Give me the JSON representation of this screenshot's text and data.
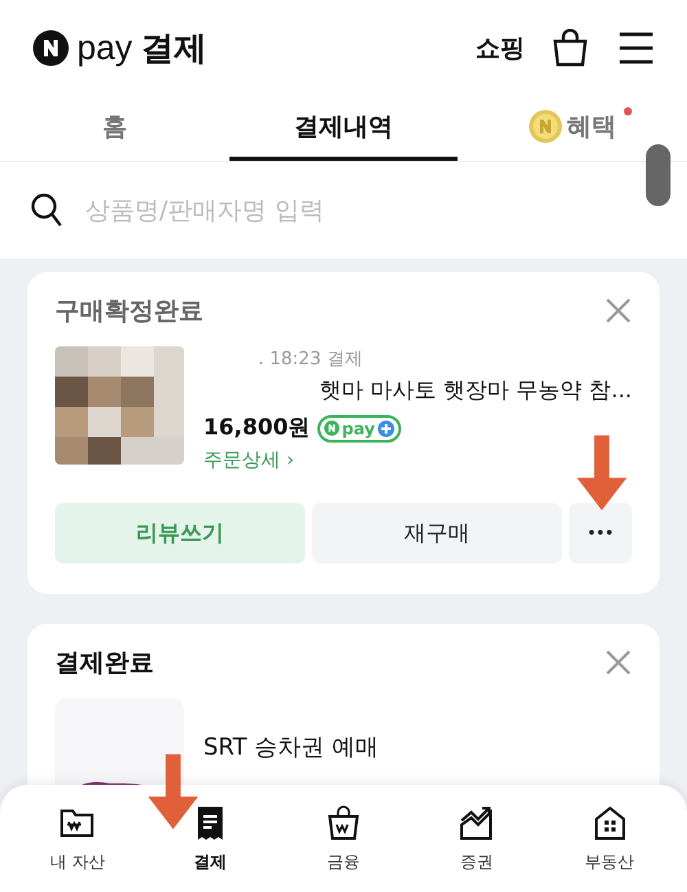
{
  "header": {
    "brand": "pay",
    "title": "결제",
    "shopping": "쇼핑"
  },
  "tabs": [
    {
      "label": "홈",
      "selected": false,
      "kind": "plain"
    },
    {
      "label": "결제내역",
      "selected": true,
      "kind": "plain"
    },
    {
      "label": "혜택",
      "selected": false,
      "kind": "coin",
      "badge": true
    }
  ],
  "search": {
    "placeholder": "상품명/판매자명 입력"
  },
  "cards": [
    {
      "status": "구매확정완료",
      "kind": "product",
      "time": ". 18:23 결제",
      "product": "햇마 마사토 햇장마 무농약 참...",
      "price": "16,800원",
      "pay_badge": "pay",
      "detail": "주문상세",
      "detail_arrow": "›",
      "buttons": [
        {
          "label": "리뷰쓰기",
          "kind": "primary"
        },
        {
          "label": "재구매",
          "kind": "secondary"
        },
        {
          "label": "•••",
          "kind": "more"
        }
      ]
    },
    {
      "status": "결제완료",
      "kind": "logo",
      "product": "SRT 승차권 예매"
    }
  ],
  "bottom_nav": [
    {
      "label": "내 자산",
      "selected": false
    },
    {
      "label": "결제",
      "selected": true
    },
    {
      "label": "금융",
      "selected": false
    },
    {
      "label": "증권",
      "selected": false
    },
    {
      "label": "부동산",
      "selected": false
    }
  ]
}
